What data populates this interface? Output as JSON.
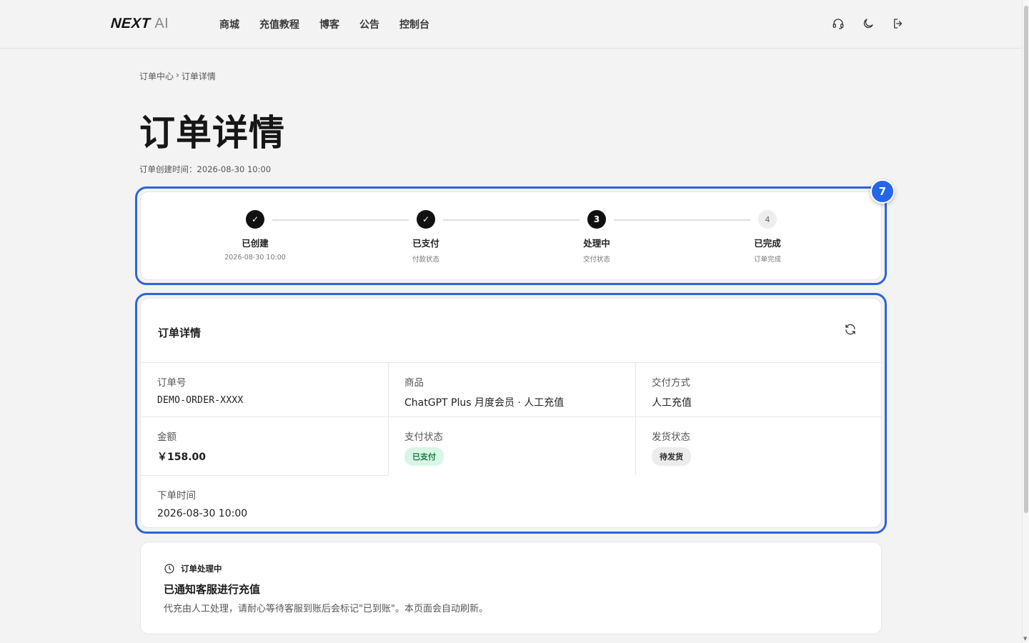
{
  "brand": {
    "name_bold": "NEXT",
    "name_light": "AI"
  },
  "nav": {
    "items": [
      {
        "label": "商城"
      },
      {
        "label": "充值教程"
      },
      {
        "label": "博客"
      },
      {
        "label": "公告"
      },
      {
        "label": "控制台"
      }
    ]
  },
  "top_actions": {
    "support_icon": "headset-icon",
    "theme_icon": "moon-icon",
    "logout_icon": "logout-icon"
  },
  "breadcrumb": {
    "root": "订单中心",
    "separator": "›",
    "current": "订单详情"
  },
  "page": {
    "title": "订单详情",
    "created_label": "订单创建时间：",
    "created_value": "2026-08-30 10:00"
  },
  "highlight": {
    "badge": "7",
    "color": "#2f64d8"
  },
  "steps": [
    {
      "marker": "✓",
      "label": "已创建",
      "sub": "2026-08-30 10:00",
      "state": "done"
    },
    {
      "marker": "✓",
      "label": "已支付",
      "sub": "付款状态",
      "state": "done"
    },
    {
      "marker": "3",
      "label": "处理中",
      "sub": "交付状态",
      "state": "current"
    },
    {
      "marker": "4",
      "label": "已完成",
      "sub": "订单完成",
      "state": "todo"
    }
  ],
  "details": {
    "title": "订单详情",
    "refresh_icon": "refresh-icon",
    "order_no": {
      "label": "订单号",
      "value": "DEMO-ORDER-XXXX"
    },
    "product": {
      "label": "商品",
      "value": "ChatGPT Plus 月度会员 · 人工充值"
    },
    "delivery_method": {
      "label": "交付方式",
      "value": "人工充值"
    },
    "amount": {
      "label": "金额",
      "value": "￥158.00"
    },
    "pay_status": {
      "label": "支付状态",
      "value": "已支付",
      "color": "#1d7a45"
    },
    "ship_status": {
      "label": "发货状态",
      "value": "待发货"
    },
    "order_time": {
      "label": "下单时间",
      "value": "2026-08-30 10:00"
    }
  },
  "processing": {
    "icon": "clock-icon",
    "heading": "订单处理中",
    "title": "已通知客服进行充值",
    "description": "代充由人工处理，请耐心等待客服到账后会标记\"已到账\"。本页面会自动刷新。"
  }
}
